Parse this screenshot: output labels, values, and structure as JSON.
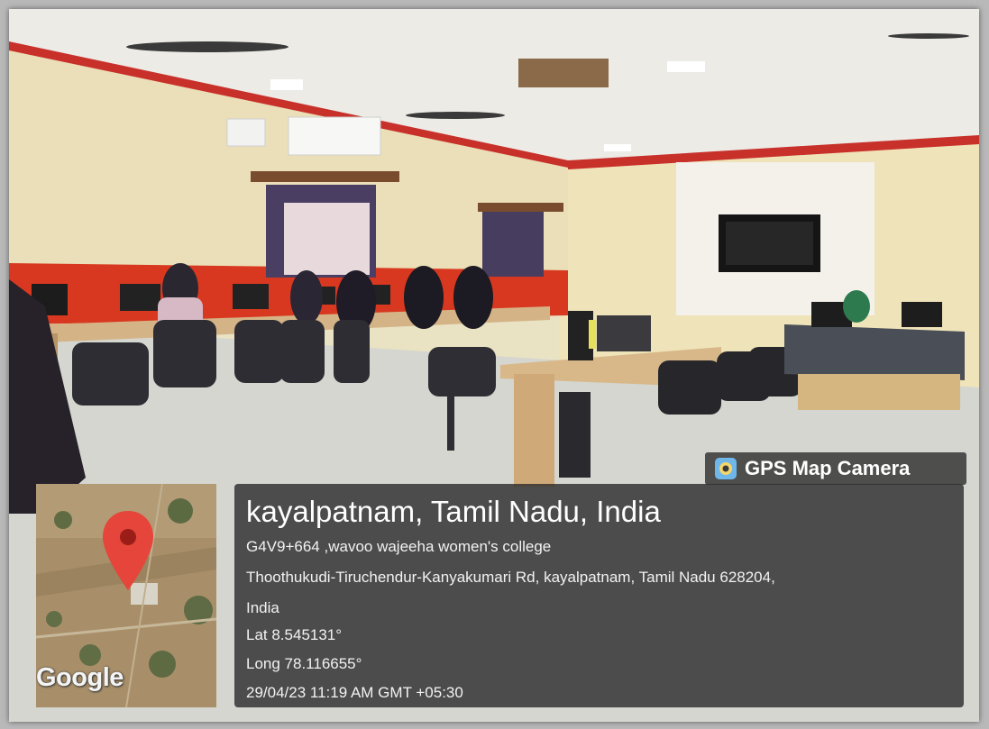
{
  "photo": {
    "description_visible": false
  },
  "watermark": {
    "label": "GPS Map Camera",
    "icon": "camera-icon"
  },
  "map": {
    "provider_label": "Google",
    "pin_color": "#e5453a",
    "pin_icon": "location-pin-icon"
  },
  "info": {
    "title": "kayalpatnam, Tamil Nadu, India",
    "plus_code_line": "G4V9+664 ,wavoo wajeeha women's college",
    "address_line": "Thoothukudi-Tiruchendur-Kanyakumari Rd, kayalpatnam, Tamil Nadu 628204,",
    "country_line": "India",
    "latitude": "Lat 8.545131°",
    "longitude": "Long 78.116655°",
    "timestamp": "29/04/23 11:19 AM GMT +05:30"
  },
  "colors": {
    "overlay": "#2d2d2d",
    "wall": "#ebe0bb",
    "accent_wall": "#d9331f"
  }
}
